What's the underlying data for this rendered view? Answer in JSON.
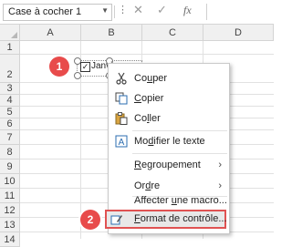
{
  "formula_bar": {
    "name_box": "Case à cocher 1",
    "dots": "⋮",
    "cancel_icon": "close-icon",
    "enter_icon": "check-icon",
    "fx": "fx",
    "formula": ""
  },
  "columns": [
    "A",
    "B",
    "C",
    "D"
  ],
  "rows": [
    "1",
    "2",
    "3",
    "4",
    "5",
    "6",
    "7",
    "8",
    "9",
    "10",
    "11",
    "12",
    "13",
    "14"
  ],
  "checkbox": {
    "label": "Janvie",
    "checked": true
  },
  "badges": {
    "first": "1",
    "second": "2"
  },
  "context_menu": {
    "items": [
      {
        "label_pre": "Co",
        "label_u": "u",
        "label_post": "per",
        "icon": "scissors-icon"
      },
      {
        "label_pre": "",
        "label_u": "C",
        "label_post": "opier",
        "icon": "copy-icon"
      },
      {
        "label_pre": "Co",
        "label_u": "l",
        "label_post": "ler",
        "icon": "paste-icon"
      },
      {
        "label_pre": "Mo",
        "label_u": "d",
        "label_post": "ifier le texte",
        "icon": "edit-text-icon"
      },
      {
        "label_pre": "",
        "label_u": "R",
        "label_post": "egroupement",
        "icon": "",
        "submenu": true
      },
      {
        "label_pre": "Or",
        "label_u": "d",
        "label_post": "re",
        "icon": "",
        "submenu": true
      },
      {
        "label_pre": "Affecter ",
        "label_u": "u",
        "label_post": "ne macro...",
        "icon": ""
      },
      {
        "label_pre": "",
        "label_u": "F",
        "label_post": "ormat de contrôle...",
        "icon": "format-control-icon"
      }
    ]
  },
  "colors": {
    "badge": "#e84b4b",
    "highlight_border": "#e05252"
  }
}
